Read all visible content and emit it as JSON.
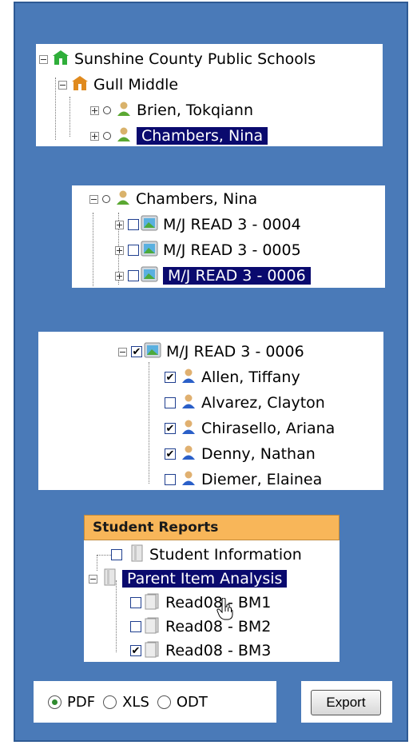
{
  "panel1": {
    "root": "Sunshine County Public Schools",
    "school": "Gull Middle",
    "teachers": [
      "Brien, Tokqiann",
      "Chambers, Nina"
    ]
  },
  "panel2": {
    "teacher": "Chambers, Nina",
    "classes": [
      "M/J READ 3 - 0004",
      "M/J READ 3 - 0005",
      "M/J READ 3 - 0006"
    ]
  },
  "panel3": {
    "class": "M/J READ 3 - 0006",
    "students": [
      {
        "name": "Allen, Tiffany",
        "checked": true
      },
      {
        "name": "Alvarez, Clayton",
        "checked": false
      },
      {
        "name": "Chirasello, Ariana",
        "checked": true
      },
      {
        "name": "Denny, Nathan",
        "checked": true
      },
      {
        "name": "Diemer, Elainea",
        "checked": false
      }
    ]
  },
  "reports": {
    "header": "Student Reports",
    "student_information": "Student Information",
    "parent_item_analysis": "Parent Item Analysis",
    "items": [
      {
        "label": "Read08 - BM1",
        "checked": false
      },
      {
        "label": "Read08 - BM2",
        "checked": false
      },
      {
        "label": "Read08 - BM3",
        "checked": true
      }
    ]
  },
  "format": {
    "options": [
      "PDF",
      "XLS",
      "ODT"
    ],
    "selected": "PDF"
  },
  "export_label": "Export",
  "colors": {
    "background": "#4a7ab8",
    "selection": "#0a0a6e",
    "header": "#f8b659"
  }
}
